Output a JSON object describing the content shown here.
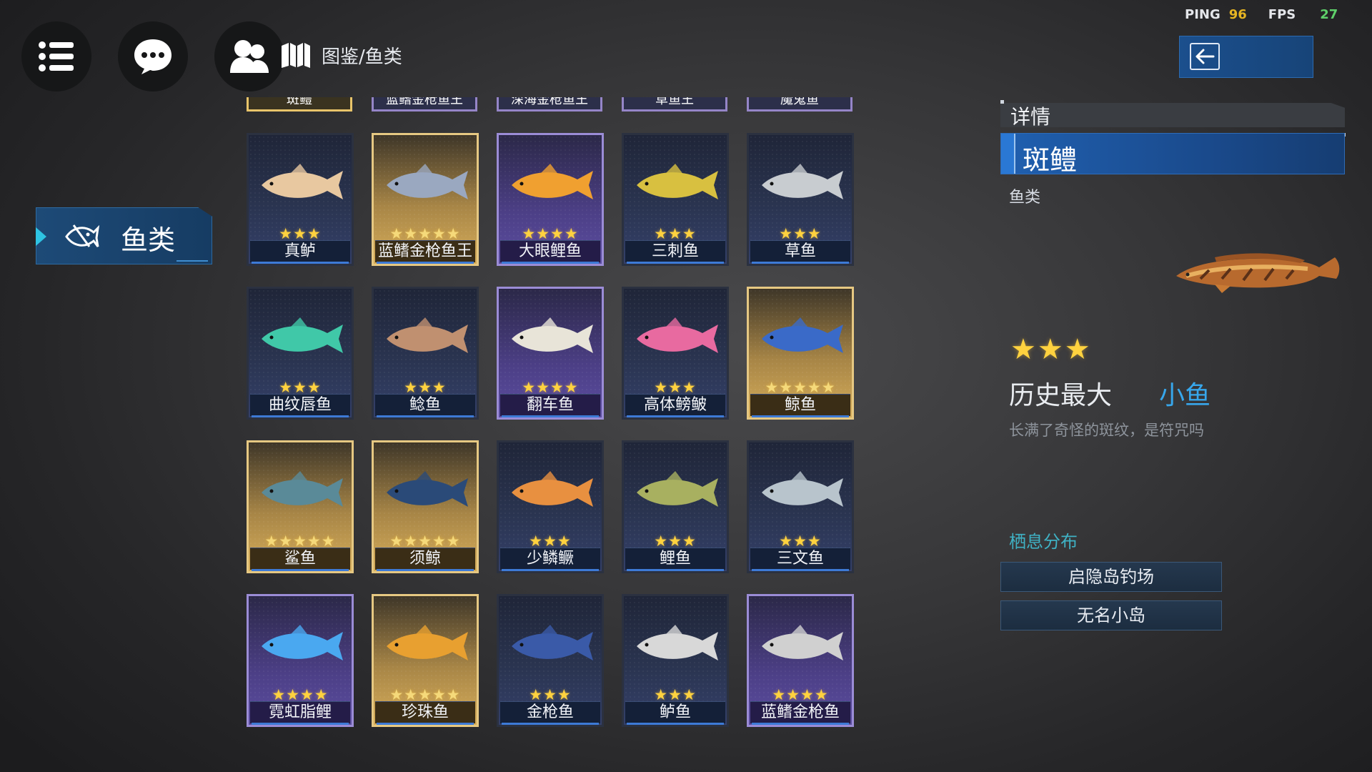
{
  "hud": {
    "ping_label": "PING",
    "ping_value": "96",
    "fps_label": "FPS",
    "fps_value": "27"
  },
  "breadcrumb": {
    "text": "图鉴/鱼类"
  },
  "sidebar": {
    "category_label": "鱼类"
  },
  "partial_row": [
    {
      "name": "斑鳢",
      "rarity": "gold"
    },
    {
      "name": "蓝鳍金枪鱼王",
      "rarity": "rare"
    },
    {
      "name": "深海金枪鱼王",
      "rarity": "rare"
    },
    {
      "name": "草鱼王",
      "rarity": "normal"
    },
    {
      "name": "魔鬼鱼",
      "rarity": "rare"
    }
  ],
  "cards": [
    {
      "name": "真鲈",
      "stars": "★★★",
      "rarity": "normal",
      "fish_color": "#e8c8a0"
    },
    {
      "name": "蓝鳍金枪鱼王",
      "stars": "★★★★★",
      "rarity": "gold",
      "fish_color": "#9aa8c0"
    },
    {
      "name": "大眼鲤鱼",
      "stars": "★★★★",
      "rarity": "rare",
      "fish_color": "#f0a030"
    },
    {
      "name": "三刺鱼",
      "stars": "★★★",
      "rarity": "normal",
      "fish_color": "#d8c040"
    },
    {
      "name": "草鱼",
      "stars": "★★★",
      "rarity": "normal",
      "fish_color": "#c8ccd0"
    },
    {
      "name": "曲纹唇鱼",
      "stars": "★★★",
      "rarity": "normal",
      "fish_color": "#40c8a8"
    },
    {
      "name": "鲶鱼",
      "stars": "★★★",
      "rarity": "normal",
      "fish_color": "#c09070"
    },
    {
      "name": "翻车鱼",
      "stars": "★★★★",
      "rarity": "rare",
      "fish_color": "#e8e4d8"
    },
    {
      "name": "高体鳑鲏",
      "stars": "★★★",
      "rarity": "normal",
      "fish_color": "#e86aa0"
    },
    {
      "name": "鲸鱼",
      "stars": "★★★★★",
      "rarity": "gold",
      "fish_color": "#3a6ac8"
    },
    {
      "name": "鲨鱼",
      "stars": "★★★★★",
      "rarity": "gold",
      "fish_color": "#5a8a98"
    },
    {
      "name": "须鲸",
      "stars": "★★★★★",
      "rarity": "gold",
      "fish_color": "#2a4a78"
    },
    {
      "name": "少鳞鳜",
      "stars": "★★★",
      "rarity": "normal",
      "fish_color": "#e89040"
    },
    {
      "name": "鲤鱼",
      "stars": "★★★",
      "rarity": "normal",
      "fish_color": "#a8b060"
    },
    {
      "name": "三文鱼",
      "stars": "★★★",
      "rarity": "normal",
      "fish_color": "#b8c4cc"
    },
    {
      "name": "霓虹脂鲤",
      "stars": "★★★★",
      "rarity": "rare",
      "fish_color": "#4aa8f0"
    },
    {
      "name": "珍珠鱼",
      "stars": "★★★★★",
      "rarity": "gold",
      "fish_color": "#e8a030"
    },
    {
      "name": "金枪鱼",
      "stars": "★★★",
      "rarity": "normal",
      "fish_color": "#3a5aa8"
    },
    {
      "name": "鲈鱼",
      "stars": "★★★",
      "rarity": "normal",
      "fish_color": "#d8d8d8"
    },
    {
      "name": "蓝鳍金枪鱼",
      "stars": "★★★★",
      "rarity": "rare",
      "fish_color": "#d0d0d0"
    }
  ],
  "detail": {
    "tab_label": "详情",
    "fish_name": "斑鳢",
    "category": "鱼类",
    "stars": "★★★",
    "record_label": "历史最大",
    "record_value": "小鱼",
    "description": "长满了奇怪的斑纹，是符咒吗",
    "habitat_label": "栖息分布",
    "locations": [
      "启隐岛钓场",
      "无名小岛"
    ]
  },
  "icons": [
    "menu-icon",
    "chat-icon",
    "friends-icon",
    "book-icon",
    "back-arrow-icon",
    "fish-category-icon"
  ],
  "colors": {
    "accent": "#1d4f8d",
    "gold_border": "#e6c882",
    "rare_border": "#9b8cd6",
    "star": "#ffd23f",
    "record_value": "#37a7ec",
    "habitat": "#3fb1c4"
  }
}
